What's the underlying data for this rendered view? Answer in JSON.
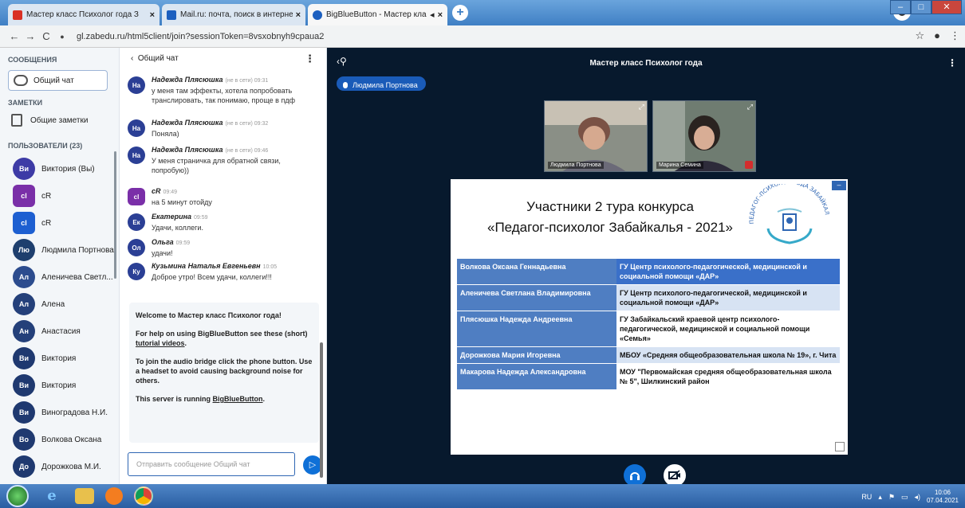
{
  "browser": {
    "tabs": [
      {
        "title": "Мастер класс Психолог года З"
      },
      {
        "title": "Mail.ru: почта, поиск в интерне"
      },
      {
        "title": "BigBlueButton - Мастер кла"
      }
    ],
    "url": "gl.zabedu.ru/html5client/join?sessionToken=8vsxobnyh9cpaua2",
    "nav": {
      "back": "←",
      "forward": "→",
      "reload": "C"
    }
  },
  "sidebar": {
    "messages_heading": "СООБЩЕНИЯ",
    "public_chat": "Общий чат",
    "notes_heading": "ЗАМЕТКИ",
    "shared_notes": "Общие заметки",
    "users_heading": "ПОЛЬЗОВАТЕЛИ (23)",
    "users": [
      {
        "initials": "Ви",
        "name": "Виктория (Вы)",
        "color": "#3d3ba6",
        "mic": "#2d9b3e"
      },
      {
        "initials": "сl",
        "name": "cR",
        "color": "#7a2fa8",
        "mic": "#d32d2d"
      },
      {
        "initials": "cl",
        "name": "cR",
        "color": "#1d5fd1",
        "mic": "#d32d2d"
      },
      {
        "initials": "Лю",
        "name": "Людмила Портнова",
        "color": "#1e3f6e",
        "mic": "#2d9b3e"
      },
      {
        "initials": "Ал",
        "name": "Аленичева Светл...",
        "color": "#2c4c8e",
        "mic": "#d32d2d"
      },
      {
        "initials": "Ал",
        "name": "Алена",
        "color": "#24407a",
        "mic": "#2d9b3e"
      },
      {
        "initials": "Ан",
        "name": "Анастасия",
        "color": "#24407a",
        "mic": "#2d9b3e"
      },
      {
        "initials": "Ви",
        "name": "Виктория",
        "color": "#1f3970",
        "mic": "#d32d2d"
      },
      {
        "initials": "Ви",
        "name": "Виктория",
        "color": "#1f3970",
        "mic": "#d32d2d"
      },
      {
        "initials": "Ви",
        "name": "Виноградова Н.И.",
        "color": "#1f3970",
        "mic": "#d32d2d"
      },
      {
        "initials": "Во",
        "name": "Волкова Оксана",
        "color": "#1f3970",
        "mic": ""
      },
      {
        "initials": "До",
        "name": "Дорожкова М.И.",
        "color": "#1f3970",
        "mic": ""
      }
    ]
  },
  "chat": {
    "header": "Общий чат",
    "messages": [
      {
        "initials": "На",
        "name": "Надежда Плясюшка",
        "meta": "(не в сети) 09:31",
        "text": "у меня там эффекты, хотела попробовать транслировать, так понимаю, проще в пдф",
        "color": "#2b3f95"
      },
      {
        "initials": "На",
        "name": "Надежда Плясюшка",
        "meta": "(не в сети) 09:32",
        "text": "Поняла)",
        "color": "#2b3f95"
      },
      {
        "initials": "На",
        "name": "Надежда Плясюшка",
        "meta": "(не в сети) 09:46",
        "text": "У меня страничка для обратной связи, попробую))",
        "color": "#2b3f95"
      },
      {
        "initials": "cl",
        "name": "cR",
        "meta": "09:49",
        "text": "на 5 минут отойду",
        "color": "#7a2fa8"
      },
      {
        "initials": "Ек",
        "name": "Екатерина",
        "meta": "09:59",
        "text": "Удачи, коллеги.",
        "color": "#2b3f95"
      },
      {
        "initials": "Ол",
        "name": "Ольга",
        "meta": "09:59",
        "text": "удачи!",
        "color": "#2b3f95"
      },
      {
        "initials": "Ку",
        "name": "Кузьмина Наталья Евгеньевн",
        "meta": "10:05",
        "text": "Доброе утро! Всем удачи, коллеги!!!",
        "color": "#2b3f95"
      }
    ],
    "welcome": {
      "line1": "Welcome to Мастер класс Психолог года!",
      "line2a": "For help on using BigBlueButton see these (short) ",
      "line2link": "tutorial videos",
      "line2b": ".",
      "line3": "To join the audio bridge click the phone button. Use a headset to avoid causing background noise for others.",
      "line4a": "This server is running ",
      "line4link": "BigBlueButton",
      "line4b": "."
    },
    "input_placeholder": "Отправить сообщение Общий чат"
  },
  "stage": {
    "title": "Мастер класс Психолог года",
    "presenter": "Людмила Портнова",
    "cams": [
      {
        "name": "Людмила Портнова"
      },
      {
        "name": "Марина Семина"
      }
    ]
  },
  "slide": {
    "title_line1": "Участники 2 тура  конкурса",
    "title_line2": "«Педагог-психолог Забайкалья - 2021»",
    "logo_text": "ПЕДАГОГ-ПСИХОЛОГ ГОДА ЗАБАЙКАЛЬЯ",
    "rows": [
      {
        "name": "Волкова Оксана Геннадьевна",
        "org": "ГУ Центр психолого-педагогической, медицинской и социальной помощи «ДАР»"
      },
      {
        "name": "Аленичева Светлана Владимировна",
        "org": "ГУ Центр психолого-педагогической, медицинской и социальной помощи «ДАР»"
      },
      {
        "name": "Плясюшка Надежда Андреевна",
        "org": "ГУ Забайкальский краевой центр психолого-педагогической, медицинской и социальной помощи «Семья»"
      },
      {
        "name": "Дорожкова Мария Игоревна",
        "org": "МБОУ «Средняя общеобразовательная школа № 19», г. Чита"
      },
      {
        "name": "Макарова Надежда Александровна",
        "org": "МОУ \"Первомайская средняя общеобразовательная школа № 5\", Шилкинский район"
      }
    ]
  },
  "taskbar": {
    "lang": "RU",
    "time": "10:06",
    "date": "07.04.2021"
  },
  "colors": {
    "accent": "#0f70d7",
    "stage_bg": "#07192d",
    "table_header": "#4f7ec2"
  }
}
